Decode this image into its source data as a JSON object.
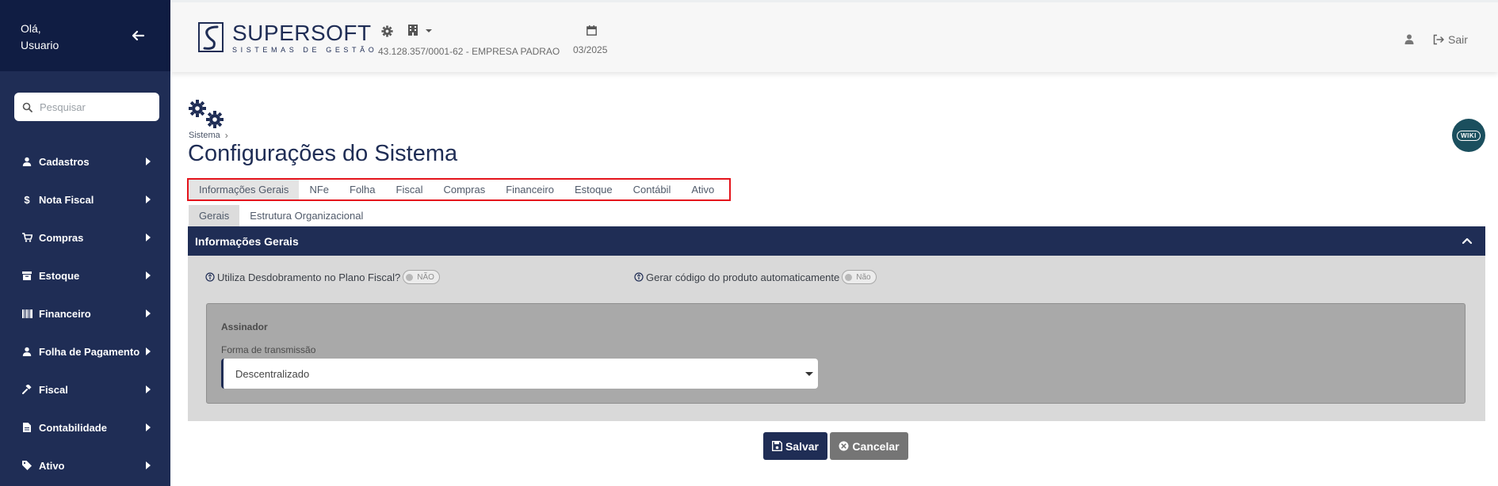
{
  "sidebar": {
    "greeting_line1": "Olá,",
    "greeting_line2": "Usuario",
    "search_placeholder": "Pesquisar",
    "items": [
      {
        "label": "Cadastros",
        "icon": "user-icon"
      },
      {
        "label": "Nota Fiscal",
        "icon": "dollar-icon"
      },
      {
        "label": "Compras",
        "icon": "cart-icon"
      },
      {
        "label": "Estoque",
        "icon": "box-icon"
      },
      {
        "label": "Financeiro",
        "icon": "barcode-icon"
      },
      {
        "label": "Folha de Pagamento",
        "icon": "user-icon"
      },
      {
        "label": "Fiscal",
        "icon": "gavel-icon"
      },
      {
        "label": "Contabilidade",
        "icon": "file-icon"
      },
      {
        "label": "Ativo",
        "icon": "tag-icon"
      }
    ]
  },
  "header": {
    "brand": "SUPERSOFT",
    "brand_sub": "SISTEMAS DE GESTÃO",
    "company": "43.128.357/0001-62 - EMPRESA PADRAO",
    "period": "03/2025",
    "logout_label": "Sair"
  },
  "page": {
    "breadcrumb": "Sistema",
    "title": "Configurações do Sistema",
    "wiki_label": "WIKI"
  },
  "tabs": [
    "Informações Gerais",
    "NFe",
    "Folha",
    "Fiscal",
    "Compras",
    "Financeiro",
    "Estoque",
    "Contábil",
    "Ativo"
  ],
  "active_tab": "Informações Gerais",
  "subtabs": [
    "Gerais",
    "Estrutura Organizacional"
  ],
  "active_subtab": "Gerais",
  "panel": {
    "title": "Informações Gerais",
    "option1_label": "Utiliza Desdobramento no Plano Fiscal?",
    "option1_value": "NÃO",
    "option2_label": "Gerar código do produto automaticamente",
    "option2_value": "Não",
    "assinador_title": "Assinador",
    "forma_label": "Forma de transmissão",
    "forma_value": "Descentralizado"
  },
  "buttons": {
    "save": "Salvar",
    "cancel": "Cancelar"
  },
  "colors": {
    "sidebar": "#1f2d55",
    "sidebar_head": "#101d43",
    "primary": "#1f2d55",
    "highlight_border": "#e4141c",
    "cancel": "#757575"
  }
}
